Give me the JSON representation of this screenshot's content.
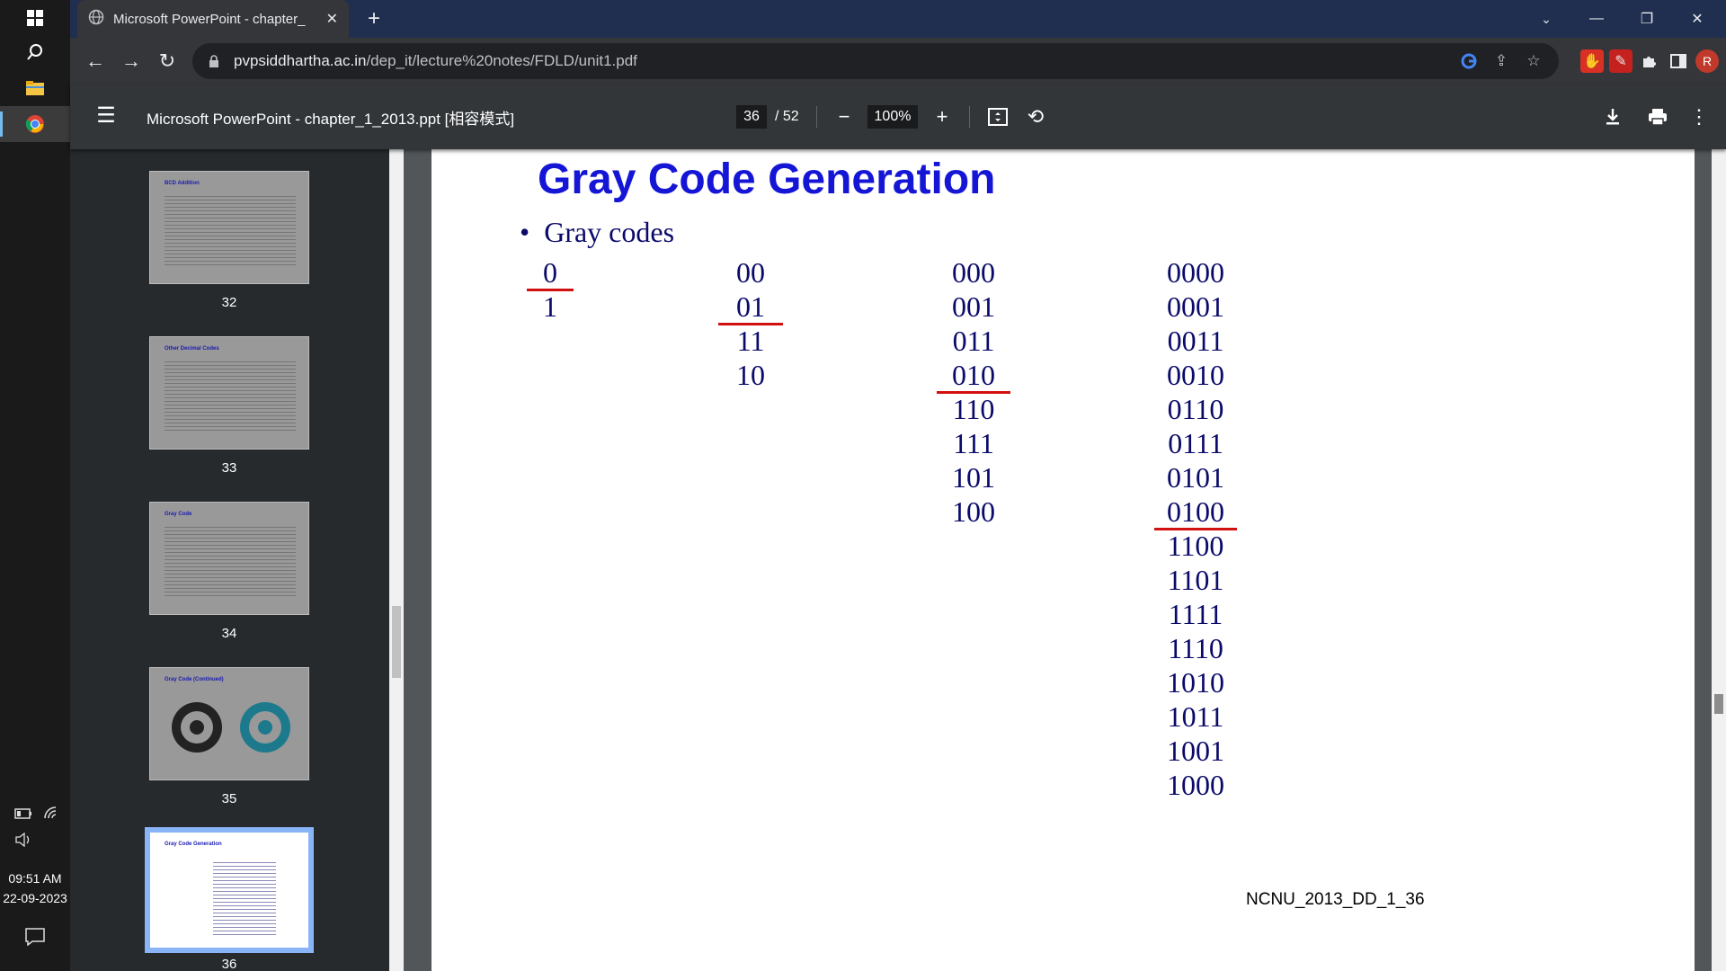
{
  "taskbar": {
    "time": "09:51 AM",
    "date": "22-09-2023"
  },
  "browser": {
    "tab_title": "Microsoft PowerPoint - chapter_",
    "url_host": "pvpsiddhartha.ac.in",
    "url_path": "/dep_it/lecture%20notes/FDLD/unit1.pdf",
    "profile_initial": "R"
  },
  "pdf": {
    "title": "Microsoft PowerPoint - chapter_1_2013.ppt [相容模式]",
    "current_page": "36",
    "total_pages": "/ 52",
    "zoom": "100%"
  },
  "thumbnails": [
    {
      "number": "32",
      "title": "BCD Addition"
    },
    {
      "number": "33",
      "title": "Other Decimal Codes"
    },
    {
      "number": "34",
      "title": "Gray Code"
    },
    {
      "number": "35",
      "title": "Gray Code (Continued)"
    },
    {
      "number": "36",
      "title": "Gray Code Generation"
    }
  ],
  "slide": {
    "title": "Gray Code Generation",
    "bullet": "Gray codes",
    "columns": [
      [
        "0",
        "1"
      ],
      [
        "00",
        "01",
        "11",
        "10"
      ],
      [
        "000",
        "001",
        "011",
        "010",
        "110",
        "111",
        "101",
        "100"
      ],
      [
        "0000",
        "0001",
        "0011",
        "0010",
        "0110",
        "0111",
        "0101",
        "0100",
        "1100",
        "1101",
        "1111",
        "1110",
        "1010",
        "1011",
        "1001",
        "1000"
      ]
    ],
    "footer": "NCNU_2013_DD_1_36"
  },
  "colors": {
    "title": "#1515d6",
    "code_text": "#0a0a6a",
    "mirror_line": "#d31010"
  }
}
